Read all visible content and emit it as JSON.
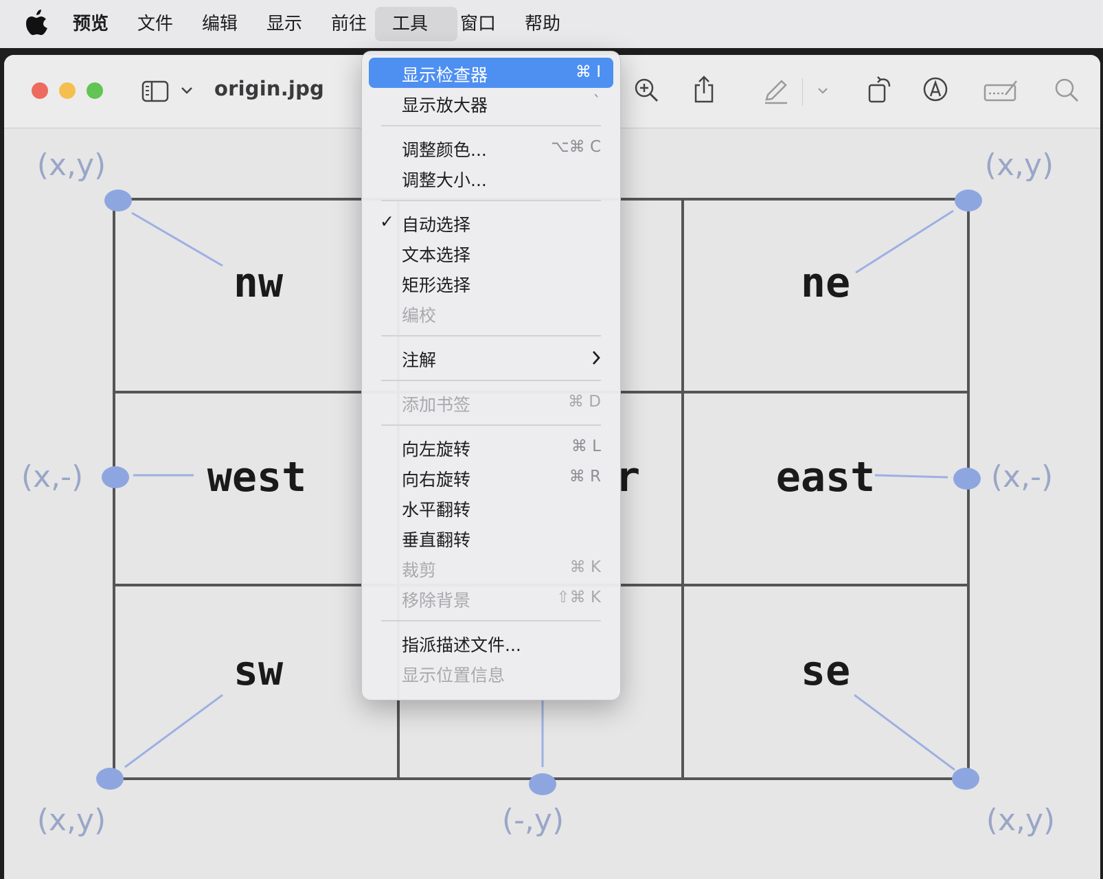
{
  "menubar": {
    "apple_icon": "apple-logo-icon",
    "items": [
      "预览",
      "文件",
      "编辑",
      "显示",
      "前往",
      "工具",
      "窗口",
      "帮助"
    ],
    "active_index": 5
  },
  "window": {
    "title": "origin.jpg",
    "toolbar_icons": [
      "sidebar-icon",
      "chevron-down-icon",
      "zoom-in-icon",
      "share-icon",
      "highlight-pen-icon",
      "chevron-down-icon",
      "rotate-icon",
      "markup-icon",
      "signature-icon",
      "search-icon"
    ]
  },
  "tools_menu": {
    "items": [
      {
        "label": "显示检查器",
        "shortcut": "⌘ I",
        "highlighted": true
      },
      {
        "label": "显示放大器",
        "shortcut": "`"
      },
      {
        "label": "调整颜色...",
        "shortcut": "⌥⌘ C"
      },
      {
        "label": "调整大小..."
      },
      {
        "label": "自动选择",
        "checked": true
      },
      {
        "label": "文本选择"
      },
      {
        "label": "矩形选择"
      },
      {
        "label": "编校",
        "disabled": true
      },
      {
        "label": "注解",
        "submenu": true
      },
      {
        "label": "添加书签",
        "shortcut": "⌘ D",
        "disabled": true
      },
      {
        "label": "向左旋转",
        "shortcut": "⌘ L"
      },
      {
        "label": "向右旋转",
        "shortcut": "⌘ R"
      },
      {
        "label": "水平翻转"
      },
      {
        "label": "垂直翻转"
      },
      {
        "label": "裁剪",
        "shortcut": "⌘ K",
        "disabled": true
      },
      {
        "label": "移除背景",
        "shortcut": "⇧⌘ K",
        "disabled": true
      },
      {
        "label": "指派描述文件..."
      },
      {
        "label": "显示位置信息",
        "disabled": true
      }
    ]
  },
  "image": {
    "labels": {
      "nw": "nw",
      "ne": "ne",
      "west": "west",
      "east": "east",
      "sw": "sw",
      "se": "se",
      "center_partial": "r"
    },
    "coords": {
      "top_left": "(x,y)",
      "top_right": "(x,y)",
      "mid_left": "(x,-)",
      "mid_right": "(x,-)",
      "bottom_left": "(x,y)",
      "bottom_center": "(-,y)",
      "bottom_right": "(x,y)"
    },
    "colors": {
      "handle": "#8ea6e0",
      "coord_text": "#9aa6c8",
      "grid": "#555555",
      "label": "#1a1a1a"
    }
  }
}
